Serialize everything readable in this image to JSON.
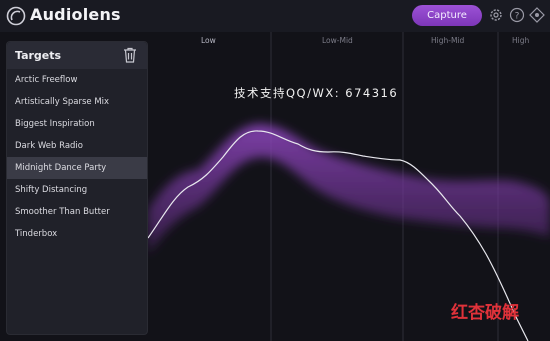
{
  "app": {
    "title": "Audiolens"
  },
  "toolbar": {
    "capture_label": "Capture",
    "icons": [
      "settings-gear-icon",
      "help-icon",
      "effects-icon"
    ]
  },
  "sidebar": {
    "title": "Targets",
    "items": [
      {
        "label": "Arctic Freeflow",
        "selected": false
      },
      {
        "label": "Artistically Sparse Mix",
        "selected": false
      },
      {
        "label": "Biggest Inspiration",
        "selected": false
      },
      {
        "label": "Dark Web Radio",
        "selected": false
      },
      {
        "label": "Midnight Dance Party",
        "selected": true
      },
      {
        "label": "Shifty Distancing",
        "selected": false
      },
      {
        "label": "Smoother Than Butter",
        "selected": false
      },
      {
        "label": "Tinderbox",
        "selected": false
      }
    ]
  },
  "graph": {
    "bands": [
      "Low",
      "Low-Mid",
      "High-Mid",
      "High"
    ]
  },
  "watermark": {
    "text": "技术支持QQ/WX: 674316"
  },
  "corner_mark": {
    "text": "红杏破解"
  },
  "colors": {
    "accent": "#8e45c9",
    "target_band": "#7a3a9e",
    "curve": "#e8e8ee",
    "background": "#121218"
  }
}
